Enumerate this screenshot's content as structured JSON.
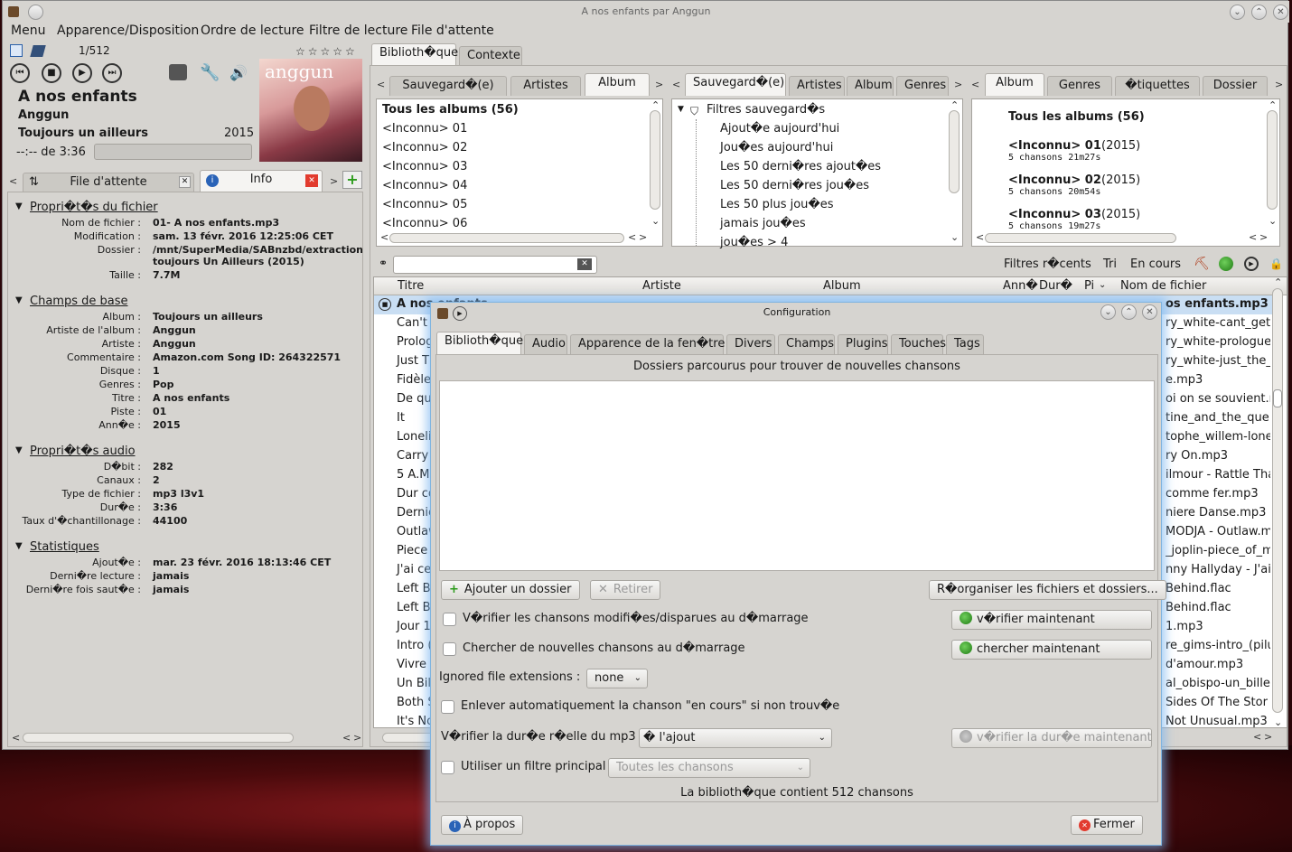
{
  "window": {
    "title": "A nos enfants par Anggun"
  },
  "menu": [
    "Menu",
    "Apparence/Disposition",
    "Ordre de lecture",
    "Filtre de lecture",
    "File d'attente"
  ],
  "player": {
    "track_count": "1/512",
    "title": "A nos enfants",
    "artist": "Anggun",
    "album": "Toujours un ailleurs",
    "year": "2015",
    "time": "--:-- de 3:36",
    "cover_text": "anggun"
  },
  "left_tabs": {
    "queue": "File d'attente",
    "info": "Info"
  },
  "info": {
    "file_section": "Propri�t�s du fichier",
    "file": [
      [
        "Nom de fichier :",
        "01- A nos enfants.mp3"
      ],
      [
        "Modification :",
        "sam. 13 févr. 2016 12:25:06 CET"
      ],
      [
        "Dossier :",
        "/mnt/SuperMedia/SABnzbd/extraction"
      ],
      [
        "",
        "toujours Un Ailleurs (2015)"
      ],
      [
        "Taille :",
        "7.7M"
      ]
    ],
    "base_section": "Champs de base",
    "base": [
      [
        "Album :",
        "Toujours un ailleurs"
      ],
      [
        "Artiste de l'album :",
        "Anggun"
      ],
      [
        "Artiste :",
        "Anggun"
      ],
      [
        "Commentaire :",
        "Amazon.com Song ID: 264322571"
      ],
      [
        "Disque :",
        "1"
      ],
      [
        "Genres :",
        "Pop"
      ],
      [
        "Titre :",
        "A nos enfants"
      ],
      [
        "Piste :",
        "01"
      ],
      [
        "Ann�e :",
        "2015"
      ]
    ],
    "audio_section": "Propri�t�s audio",
    "audio": [
      [
        "D�bit :",
        "282"
      ],
      [
        "Canaux :",
        "2"
      ],
      [
        "Type de fichier :",
        "mp3 l3v1"
      ],
      [
        "Dur�e :",
        "3:36"
      ],
      [
        "Taux d'�chantillonage :",
        "44100"
      ]
    ],
    "stats_section": "Statistiques",
    "stats": [
      [
        "Ajout�e :",
        "mar. 23 févr. 2016 18:13:46 CET"
      ],
      [
        "Derni�re lecture :",
        "jamais"
      ],
      [
        "Derni�re fois saut�e :",
        "jamais"
      ]
    ]
  },
  "top_tabs": [
    "Biblioth�que",
    "Contexte"
  ],
  "browser1": {
    "tabs": [
      "Sauvegard�(e)",
      "Artistes",
      "Album"
    ],
    "items": [
      "Tous les albums (56)",
      "<Inconnu> 01",
      "<Inconnu> 02",
      "<Inconnu> 03",
      "<Inconnu> 04",
      "<Inconnu> 05",
      "<Inconnu> 06"
    ]
  },
  "browser2": {
    "tabs": [
      "Sauvegard�(e)",
      "Artistes",
      "Album",
      "Genres"
    ],
    "root": "Filtres sauvegard�s",
    "items": [
      "Ajout�e aujourd'hui",
      "Jou�es aujourd'hui",
      "Les 50 derni�res ajout�es",
      "Les 50 derni�res jou�es",
      "Les 50 plus jou�es",
      "jamais jou�es",
      "jou�es > 4"
    ]
  },
  "browser3": {
    "tabs": [
      "Album",
      "Genres",
      "�tiquettes",
      "Dossier"
    ],
    "all": "Tous les albums (56)",
    "albums": [
      {
        "name": "<Inconnu> 01",
        "year": "(2015)",
        "sub": "5 chansons 21m27s"
      },
      {
        "name": "<Inconnu> 02",
        "year": "(2015)",
        "sub": "5 chansons 20m54s"
      },
      {
        "name": "<Inconnu> 03",
        "year": "(2015)",
        "sub": "5 chansons 19m27s"
      }
    ]
  },
  "songlist": {
    "toolbar": [
      "Filtres r�cents",
      "Tri",
      "En cours"
    ],
    "columns": [
      "Titre",
      "Artiste",
      "Album",
      "Ann�",
      "Dur�",
      "Pi",
      "Nom de fichier"
    ],
    "titles": [
      "A nos enfants",
      "Can't",
      "Prolog",
      "Just Th",
      "Fidèle",
      "De qu",
      "It",
      "Loneli",
      "Carry",
      "5 A.M.",
      "Dur co",
      "Derniè",
      "Outlaw",
      "Piece",
      "J'ai ce",
      "Left Be",
      "Left Be",
      "Jour 1",
      "Intro (",
      "Vivre",
      "Un Bill",
      "Both S",
      "It's No"
    ],
    "files": [
      "os enfants.mp3",
      "ry_white-cant_get_",
      "ry_white-prologue.",
      "ry_white-just_the_",
      "e.mp3",
      "oi on se souvient.r",
      "tine_and_the_que",
      "tophe_willem-lone",
      "ry On.mp3",
      "ilmour - Rattle Tha",
      "comme fer.mp3",
      "niere Danse.mp3",
      "MODJA - Outlaw.m",
      "_joplin-piece_of_m",
      "nny Hallyday - J'ai c",
      "Behind.flac",
      "Behind.flac",
      "1.mp3",
      "re_gims-intro_(pilu",
      "d'amour.mp3",
      "al_obispo-un_billet",
      "Sides Of The Stor",
      "Not Unusual.mp3"
    ]
  },
  "dialog": {
    "title": "Configuration",
    "tabs": [
      "Biblioth�que",
      "Audio",
      "Apparence de la fen�tre",
      "Divers",
      "Champs",
      "Plugins",
      "Touches",
      "Tags"
    ],
    "folders_label": "Dossiers parcourus pour trouver de nouvelles chansons",
    "add_folder": "Ajouter un dossier",
    "remove": "Retirer",
    "reorganize": "R�organiser les fichiers et dossiers...",
    "check_modified": "V�rifier les chansons modifi�es/disparues au d�marrage",
    "check_now": "v�rifier maintenant",
    "search_new": "Chercher de nouvelles chansons au d�marrage",
    "search_now": "chercher maintenant",
    "ignored_label": "Ignored file extensions :",
    "ignored_value": "none",
    "auto_remove": "Enlever automatiquement la chanson \"en cours\" si non trouv�e",
    "verify_duration_label": "V�rifier la dur�e r�elle du mp3",
    "verify_duration_value": "� l'ajout",
    "verify_duration_now": "v�rifier la dur�e maintenant",
    "main_filter": "Utiliser un filtre principal",
    "main_filter_value": "Toutes les chansons",
    "library_count": "La biblioth�que contient 512 chansons",
    "about": "À propos",
    "close": "Fermer"
  }
}
